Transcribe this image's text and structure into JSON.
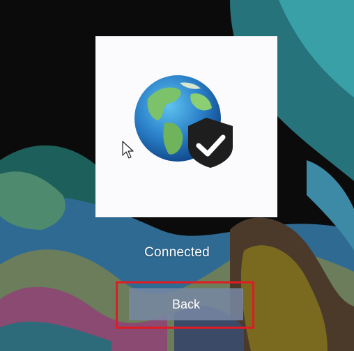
{
  "status": {
    "text": "Connected"
  },
  "back_button": {
    "label": "Back"
  },
  "icons": {
    "main": "globe-shield-check-icon",
    "pointer": "mouse-pointer-icon"
  },
  "colors": {
    "card_background": "#fbfbfd",
    "button_background": "#7887a5",
    "highlight_border": "#e01b24",
    "text": "#ffffff"
  }
}
